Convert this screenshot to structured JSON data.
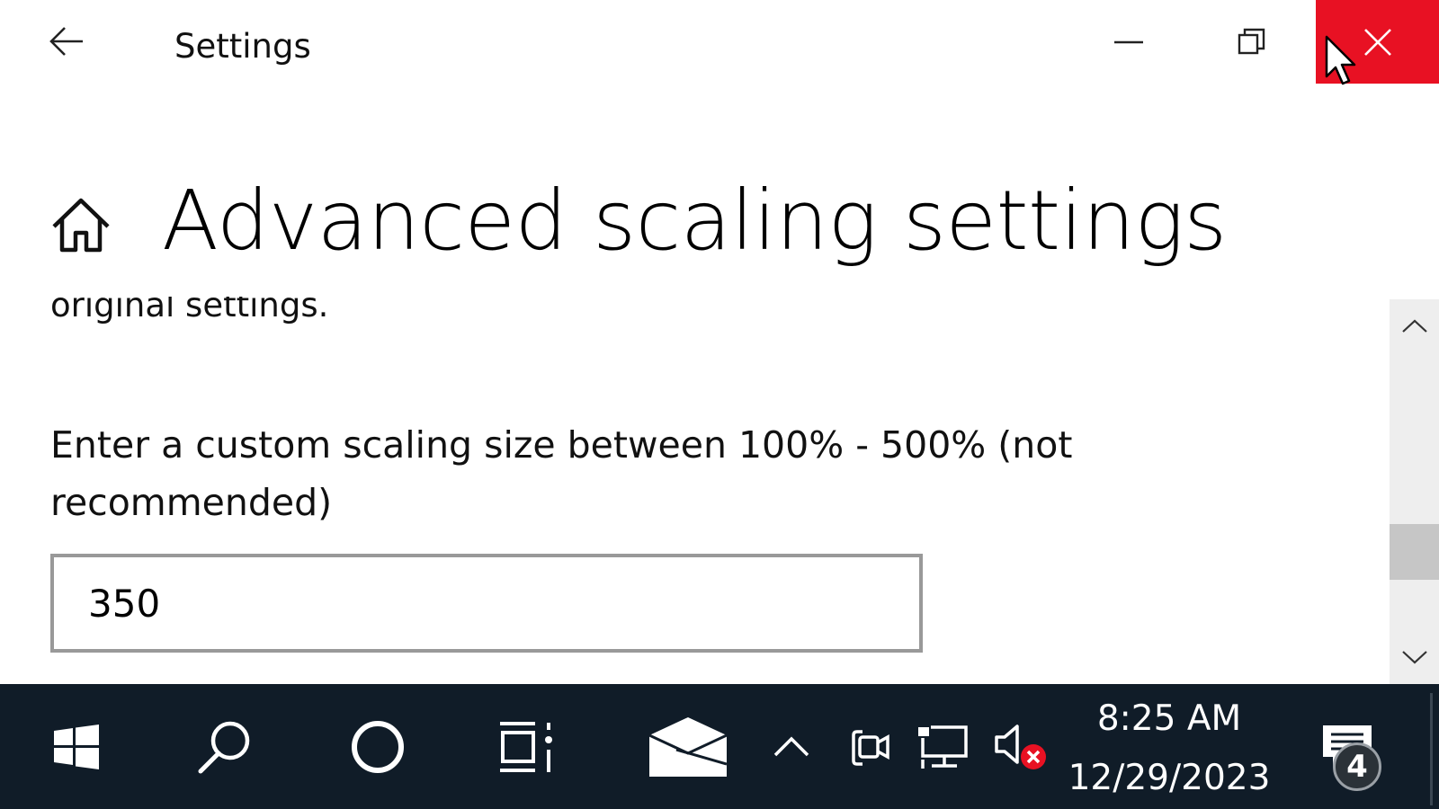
{
  "window": {
    "title": "Settings",
    "controls": {
      "minimize": "minimize-icon",
      "maximize": "restore-icon",
      "close": "close-icon"
    },
    "close_hover_color": "#e81123"
  },
  "page": {
    "title": "Advanced scaling settings",
    "partial_text": "original settings.",
    "custom_scaling_label": "Enter a custom scaling size between 100% - 500% (not recommended)",
    "custom_scaling_value": "350"
  },
  "taskbar": {
    "icons": [
      "windows-start-icon",
      "search-icon",
      "cortana-icon",
      "task-view-icon",
      "mail-icon",
      "show-hidden-icons-chevron",
      "meet-now-icon",
      "network-icon",
      "volume-muted-icon",
      "action-center-icon"
    ],
    "clock": {
      "time": "8:25 AM",
      "date": "12/29/2023"
    },
    "notification_count": "4",
    "background_color": "#101c28"
  }
}
